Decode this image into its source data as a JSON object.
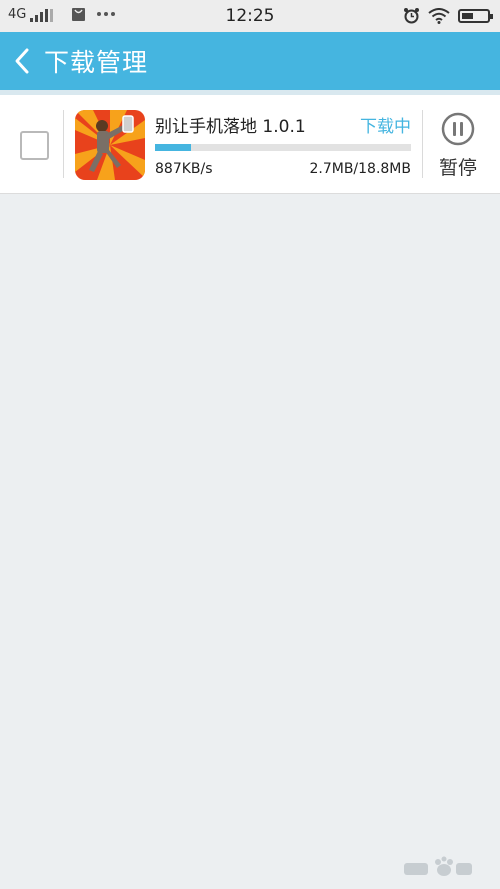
{
  "status_bar": {
    "network": "4G",
    "time": "12:25",
    "icons": [
      "signal-icon",
      "notification-bag-icon",
      "more-icon",
      "alarm-icon",
      "wifi-icon",
      "battery-icon"
    ]
  },
  "header": {
    "title": "下载管理",
    "back_icon": "chevron-left-icon",
    "background": "#45b5e0"
  },
  "downloads": [
    {
      "name": "别让手机落地 1.0.1",
      "status": "下载中",
      "speed": "887KB/s",
      "size": "2.7MB/18.8MB",
      "progress": 0.14,
      "checked": false,
      "action_label": "暂停",
      "action_icon": "pause-circle-icon"
    }
  ],
  "colors": {
    "accent": "#45b5e0",
    "background": "#eceff1"
  }
}
